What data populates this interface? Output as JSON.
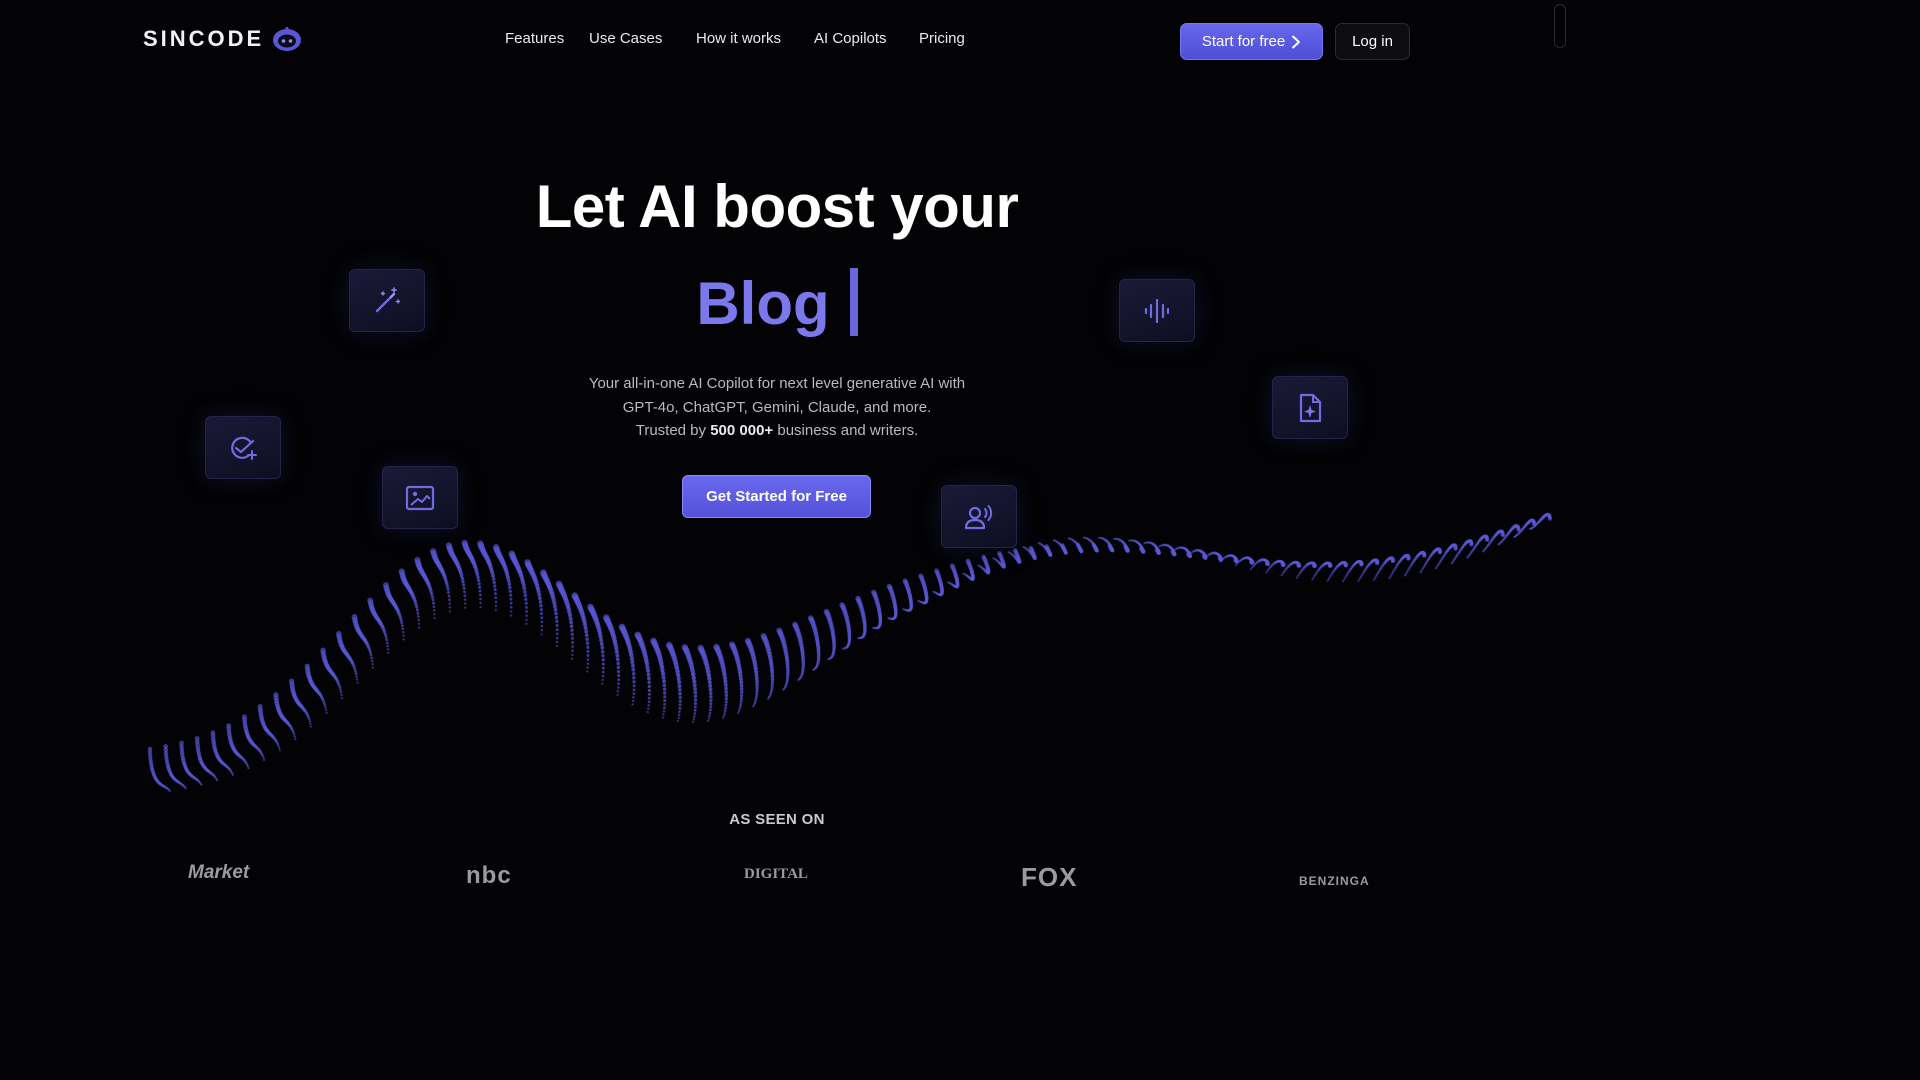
{
  "header": {
    "logo_text": "SINCODE",
    "nav": [
      "Features",
      "Use Cases",
      "How it works",
      "AI Copilots",
      "Pricing"
    ],
    "start_label": "Start for free",
    "login_label": "Log in"
  },
  "hero": {
    "title": "Let AI boost your",
    "rotating_word": "Blog",
    "subtitle_line1": "Your all-in-one AI Copilot for next level generative AI with",
    "subtitle_line2": "GPT-4o, ChatGPT, Gemini, Claude, and more.",
    "trusted_prefix": "Trusted by",
    "trusted_count": "500 000+",
    "trusted_suffix": "business and writers.",
    "cta_label": "Get Started for Free"
  },
  "feature_tiles": [
    {
      "icon": "magic-wand-icon"
    },
    {
      "icon": "check-plus-icon"
    },
    {
      "icon": "image-icon"
    },
    {
      "icon": "audio-wave-icon"
    },
    {
      "icon": "sparkle-document-icon"
    },
    {
      "icon": "voice-user-icon"
    }
  ],
  "press": {
    "heading": "AS SEEN ON",
    "logos": [
      "Market",
      "nbc",
      "DIGITAL",
      "FOX",
      "BENZINGA"
    ]
  },
  "colors": {
    "background": "#030305",
    "accent": "#5b59e0",
    "accent_text": "#7b78ec"
  }
}
